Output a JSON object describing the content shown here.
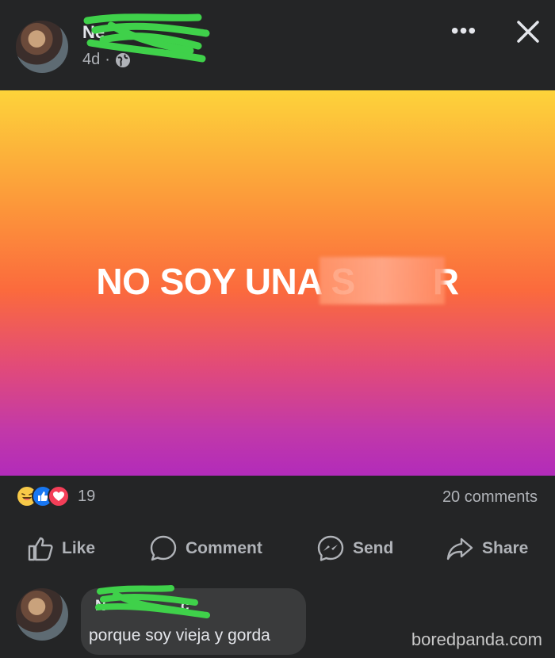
{
  "post": {
    "author_visible_initial": "Ne",
    "timestamp": "4d",
    "separator": "·",
    "privacy_icon": "globe-icon",
    "banner_text": "NO SOY UNA S        R",
    "banner_colors": [
      "#fdd33a",
      "#fb6a3d",
      "#b22bba"
    ]
  },
  "header": {
    "more_label": "•••",
    "close_icon": "close-icon"
  },
  "stats": {
    "reaction_icons": [
      "haha-reaction-icon",
      "like-reaction-icon",
      "love-reaction-icon"
    ],
    "reaction_count": "19",
    "comments_count": "20 comments"
  },
  "actions": {
    "like_label": "Like",
    "comment_label": "Comment",
    "send_label": "Send",
    "share_label": "Share"
  },
  "comment": {
    "author_visible_initial": "N",
    "author_visible_tail": "c",
    "text": "porque soy vieja y gorda"
  },
  "watermark": "boredpanda.com",
  "colors": {
    "background": "#242526",
    "text_primary": "#e4e6eb",
    "text_secondary": "#b0b3b8",
    "scribble": "#3fd14a"
  }
}
